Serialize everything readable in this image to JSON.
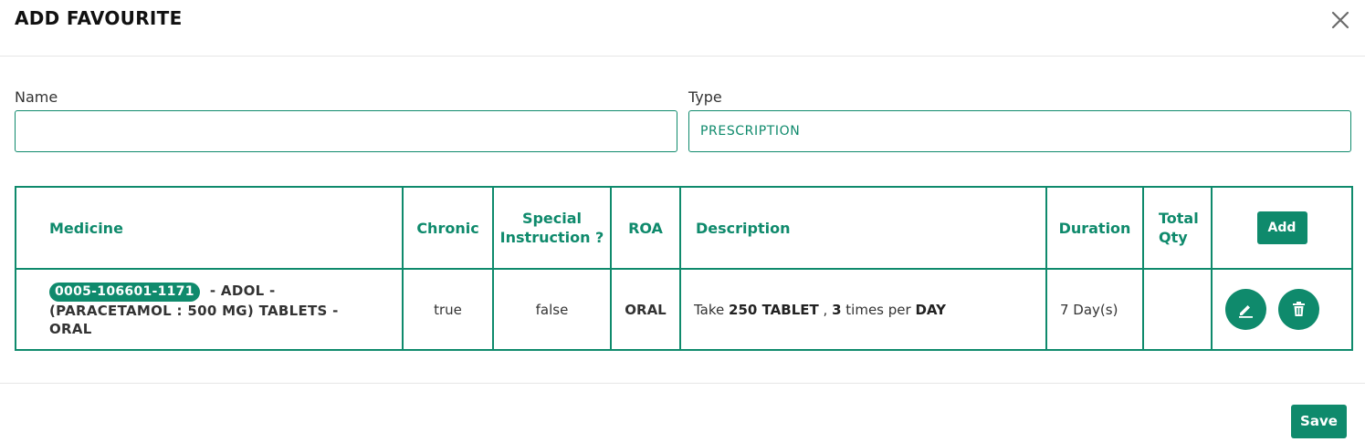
{
  "dialog": {
    "title": "ADD FAVOURITE",
    "close_icon": "close-icon"
  },
  "form": {
    "name_label": "Name",
    "name_value": "",
    "type_label": "Type",
    "type_value": "PRESCRIPTION"
  },
  "table": {
    "headers": {
      "medicine": "Medicine",
      "chronic": "Chronic",
      "special_instruction": "Special Instruction ?",
      "roa": "ROA",
      "description": "Description",
      "duration": "Duration",
      "total_qty": "Total Qty",
      "add_label": "Add"
    },
    "rows": [
      {
        "medicine_code": "0005-106601-1171",
        "medicine_name": "- ADOL - (PARACETAMOL : 500 MG) TABLETS - ORAL",
        "chronic": "true",
        "special_instruction": "false",
        "roa": "ORAL",
        "description": {
          "prefix": "Take",
          "amount": "250 TABLET",
          "sep": ",",
          "times": "3",
          "times_suffix": "times per",
          "period": "DAY"
        },
        "duration": "7 Day(s)",
        "total_qty": "",
        "edit_icon": "edit-icon",
        "delete_icon": "trash-icon"
      }
    ]
  },
  "footer": {
    "save_label": "Save"
  },
  "colors": {
    "accent": "#0f8a6c"
  }
}
